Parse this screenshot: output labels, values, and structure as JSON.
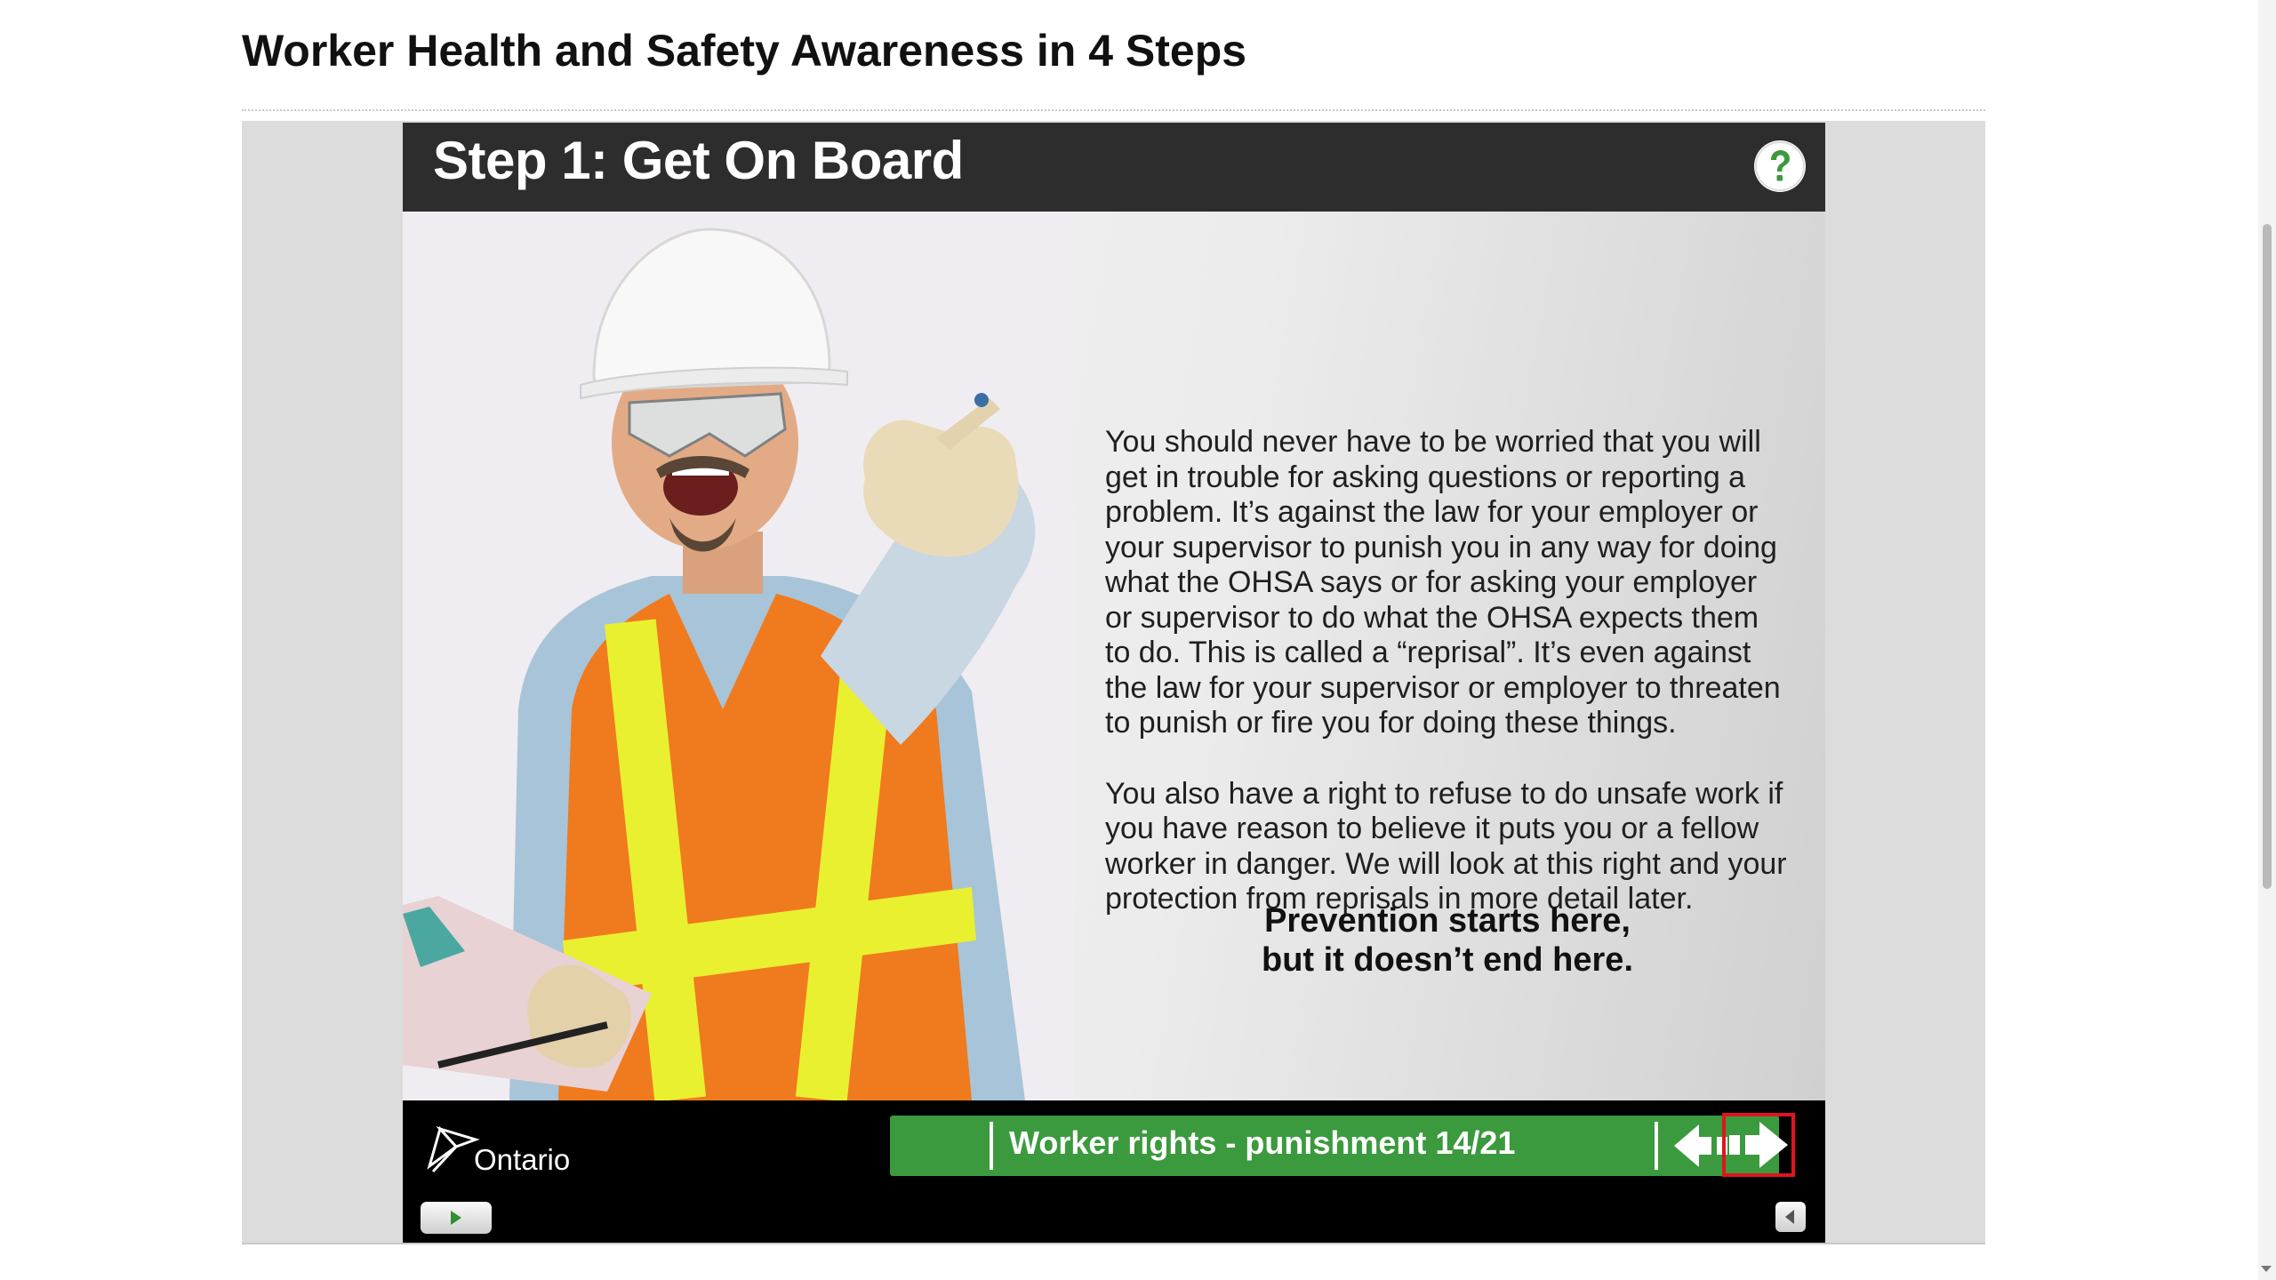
{
  "page": {
    "title": "Worker Health and Safety Awareness in 4 Steps"
  },
  "slide": {
    "title": "Step 1: Get On Board",
    "help_icon": "question-mark-icon",
    "paragraphs": [
      "You should never have to be worried that you will get in trouble for asking questions or reporting a problem. It’s against the law for your employer or your supervisor to punish you in any way for doing what the OHSA says or for asking your employer or supervisor to do what the OHSA expects them to do. This is called a “reprisal”. It’s even against the law for your supervisor or employer to threaten to punish or fire you for doing these things.",
      "You also have a right to refuse to do unsafe work if you have reason to believe it puts you or a fellow worker in danger. We will look at this right and your protection from reprisals in more detail later."
    ],
    "tagline_line1": "Prevention starts here,",
    "tagline_line2": "but it doesn’t end here."
  },
  "footer": {
    "logo_text": "Ontario",
    "status": "Worker rights - punishment 14/21",
    "prev_icon": "previous-arrow-icon",
    "next_icon": "next-arrow-icon",
    "play_icon": "play-icon",
    "mute_icon": "speaker-icon"
  },
  "colors": {
    "nav_green": "#3b9a3e",
    "highlight_red": "#e0141c",
    "header_dark": "#2d2d2d",
    "help_green": "#3b9a3e"
  }
}
